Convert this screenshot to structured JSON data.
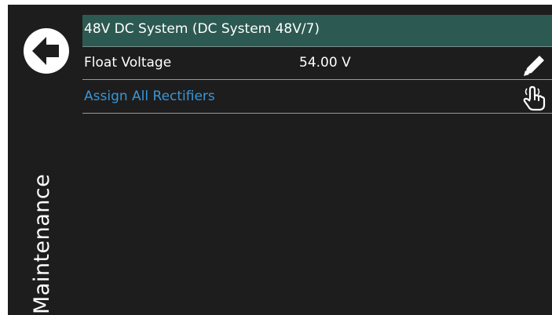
{
  "header": {
    "title": "48V DC System (DC System 48V/7)"
  },
  "sidebar": {
    "title": "Maintenance",
    "back_icon": "back-arrow-circle-icon"
  },
  "rows": [
    {
      "label": "Float Voltage",
      "value": "54.00 V",
      "icon": "pencil-edit-icon"
    },
    {
      "label": "Assign All Rectifiers",
      "icon": "hand-pointer-icon"
    }
  ],
  "colors": {
    "background": "#1d1d1d",
    "header_bg": "#2c5a52",
    "link": "#3a96d8",
    "text": "#ffffff",
    "separator": "#9a9a9a"
  }
}
